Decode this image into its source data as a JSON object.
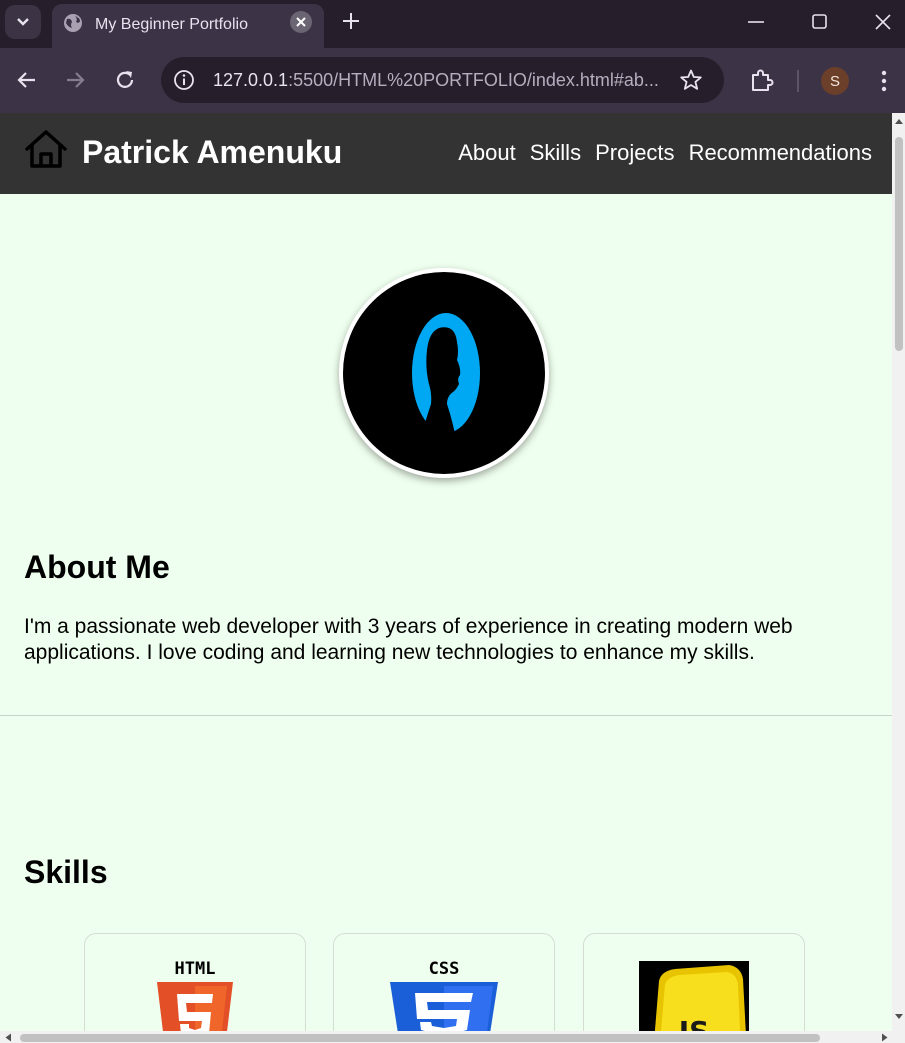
{
  "browser": {
    "tab_title": "My Beginner Portfolio",
    "url_host": "127.0.0.1",
    "url_rest": ":5500/HTML%20PORTFOLIO/index.html#ab...",
    "profile_initial": "S"
  },
  "site": {
    "name": "Patrick Amenuku",
    "nav": [
      "About",
      "Skills",
      "Projects",
      "Recommendations"
    ]
  },
  "about": {
    "title": "About Me",
    "text": "I'm a passionate web developer with 3 years of experience in creating modern web applications. I love coding and learning new technologies to enhance my skills."
  },
  "skills": {
    "title": "Skills",
    "items": [
      {
        "name": "HTML",
        "icon": "html5-logo",
        "color": "#e34f26"
      },
      {
        "name": "CSS",
        "icon": "css3-logo",
        "color": "#1572b6"
      },
      {
        "name": "JS",
        "icon": "javascript-logo",
        "color": "#f7df1e"
      }
    ]
  },
  "colors": {
    "page_bg": "#efffef",
    "header_bg": "#333333",
    "profile_glow": "#00aaff"
  }
}
